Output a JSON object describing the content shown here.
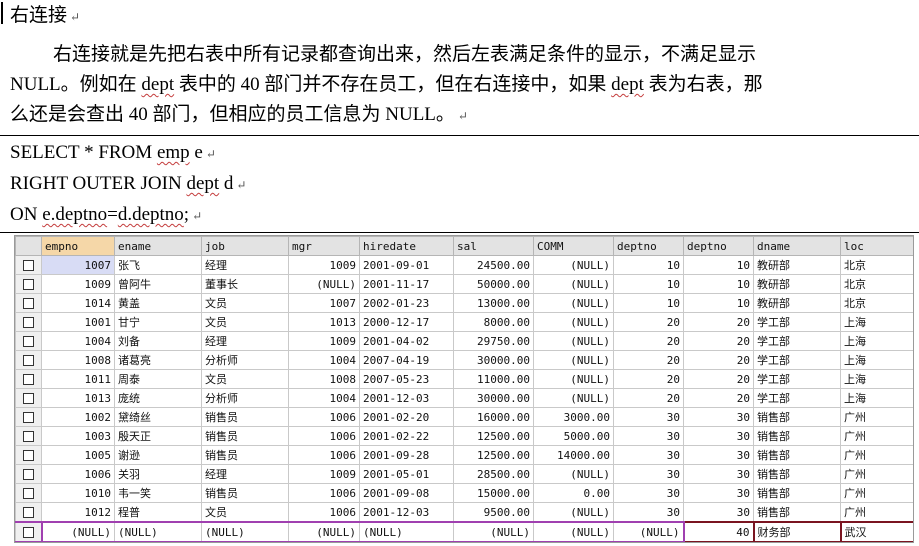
{
  "heading": "右连接",
  "paragraph": {
    "l1": "右连接就是先把右表中所有记录都查询出来，然后左表满足条件的显示，不满足显示",
    "l2_a": "NULL。例如在 ",
    "l2_b": "dept",
    "l2_c": " 表中的 40 部门并不存在员工，但在右连接中，如果 ",
    "l2_d": "dept",
    "l2_e": " 表为右表，那",
    "l3": "么还是会查出 40 部门，但相应的员工信息为 NULL。"
  },
  "paragraph_mark": "↵",
  "code": {
    "line1_a": "SELECT * FROM ",
    "line1_b": "emp",
    "line1_c": " e",
    "line2_a": "RIGHT OUTER JOIN ",
    "line2_b": "dept",
    "line2_c": " d",
    "line3_a": "ON ",
    "line3_b": "e.deptno",
    "line3_c": "=",
    "line3_d": "d.deptno",
    "line3_e": ";"
  },
  "table": {
    "columns": [
      "empno",
      "ename",
      "job",
      "mgr",
      "hiredate",
      "sal",
      "COMM",
      "deptno",
      "deptno",
      "dname",
      "loc"
    ],
    "rows": [
      [
        "1007",
        "张飞",
        "经理",
        "1009",
        "2001-09-01",
        "24500.00",
        "(NULL)",
        "10",
        "10",
        "教研部",
        "北京"
      ],
      [
        "1009",
        "曾阿牛",
        "董事长",
        "(NULL)",
        "2001-11-17",
        "50000.00",
        "(NULL)",
        "10",
        "10",
        "教研部",
        "北京"
      ],
      [
        "1014",
        "黄盖",
        "文员",
        "1007",
        "2002-01-23",
        "13000.00",
        "(NULL)",
        "10",
        "10",
        "教研部",
        "北京"
      ],
      [
        "1001",
        "甘宁",
        "文员",
        "1013",
        "2000-12-17",
        "8000.00",
        "(NULL)",
        "20",
        "20",
        "学工部",
        "上海"
      ],
      [
        "1004",
        "刘备",
        "经理",
        "1009",
        "2001-04-02",
        "29750.00",
        "(NULL)",
        "20",
        "20",
        "学工部",
        "上海"
      ],
      [
        "1008",
        "诸葛亮",
        "分析师",
        "1004",
        "2007-04-19",
        "30000.00",
        "(NULL)",
        "20",
        "20",
        "学工部",
        "上海"
      ],
      [
        "1011",
        "周泰",
        "文员",
        "1008",
        "2007-05-23",
        "11000.00",
        "(NULL)",
        "20",
        "20",
        "学工部",
        "上海"
      ],
      [
        "1013",
        "庞统",
        "分析师",
        "1004",
        "2001-12-03",
        "30000.00",
        "(NULL)",
        "20",
        "20",
        "学工部",
        "上海"
      ],
      [
        "1002",
        "黛绮丝",
        "销售员",
        "1006",
        "2001-02-20",
        "16000.00",
        "3000.00",
        "30",
        "30",
        "销售部",
        "广州"
      ],
      [
        "1003",
        "殷天正",
        "销售员",
        "1006",
        "2001-02-22",
        "12500.00",
        "5000.00",
        "30",
        "30",
        "销售部",
        "广州"
      ],
      [
        "1005",
        "谢逊",
        "销售员",
        "1006",
        "2001-09-28",
        "12500.00",
        "14000.00",
        "30",
        "30",
        "销售部",
        "广州"
      ],
      [
        "1006",
        "关羽",
        "经理",
        "1009",
        "2001-05-01",
        "28500.00",
        "(NULL)",
        "30",
        "30",
        "销售部",
        "广州"
      ],
      [
        "1010",
        "韦一笑",
        "销售员",
        "1006",
        "2001-09-08",
        "15000.00",
        "0.00",
        "30",
        "30",
        "销售部",
        "广州"
      ],
      [
        "1012",
        "程普",
        "文员",
        "1006",
        "2001-12-03",
        "9500.00",
        "(NULL)",
        "30",
        "30",
        "销售部",
        "广州"
      ],
      [
        "(NULL)",
        "(NULL)",
        "(NULL)",
        "(NULL)",
        "(NULL)",
        "(NULL)",
        "(NULL)",
        "(NULL)",
        "40",
        "财务部",
        "武汉"
      ]
    ],
    "highlight_colors": {
      "left_part": "#a040b0",
      "right_part": "#7a1420"
    }
  }
}
